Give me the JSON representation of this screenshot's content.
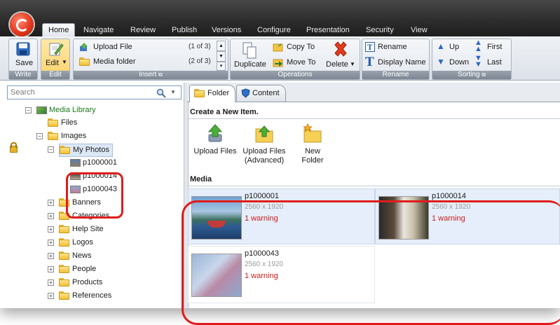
{
  "ribbon": {
    "tabs": [
      "Home",
      "Navigate",
      "Review",
      "Publish",
      "Versions",
      "Configure",
      "Presentation",
      "Security",
      "View"
    ],
    "active_tab": "Home",
    "write": {
      "save_label": "Save",
      "group": "Write"
    },
    "edit": {
      "edit_label": "Edit",
      "group": "Edit"
    },
    "insert": {
      "upload_file": "Upload File",
      "upload_file_count": "(1 of 3)",
      "media_folder": "Media folder",
      "media_folder_count": "(2 of 3)",
      "group": "Insert"
    },
    "operations": {
      "duplicate": "Duplicate",
      "copy_to": "Copy To",
      "move_to": "Move To",
      "delete": "Delete",
      "group": "Operations"
    },
    "rename": {
      "rename": "Rename",
      "display_name": "Display Name",
      "group": "Rename"
    },
    "sorting": {
      "up": "Up",
      "down": "Down",
      "first": "First",
      "last": "Last",
      "group": "Sorting"
    }
  },
  "search": {
    "placeholder": "Search"
  },
  "tree": {
    "root": "Media Library",
    "files": "Files",
    "images": "Images",
    "my_photos": "My Photos",
    "photos": [
      "p1000001",
      "p1000014",
      "p1000043"
    ],
    "folders": [
      "Banners",
      "Categories",
      "Help Site",
      "Logos",
      "News",
      "People",
      "Products",
      "References"
    ]
  },
  "content_tabs": [
    "Folder",
    "Content"
  ],
  "create_header": "Create a New Item.",
  "actions": [
    {
      "line1": "Upload Files",
      "line2": ""
    },
    {
      "line1": "Upload Files",
      "line2": "(Advanced)"
    },
    {
      "line1": "New Folder",
      "line2": ""
    }
  ],
  "media_header": "Media",
  "media": [
    {
      "name": "p1000001",
      "size": "2560 x 1920",
      "warning": "1 warning"
    },
    {
      "name": "p1000014",
      "size": "2560 x 1920",
      "warning": "1 warning"
    },
    {
      "name": "p1000043",
      "size": "2560 x 1920",
      "warning": "1 warning"
    }
  ]
}
